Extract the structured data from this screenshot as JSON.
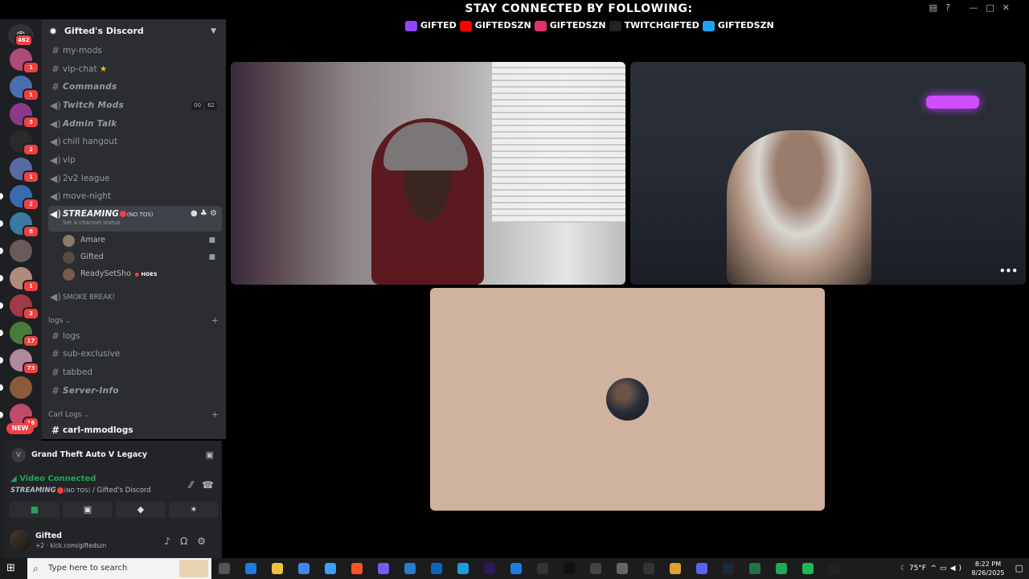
{
  "rail": {
    "home_badge": "462",
    "new_label": "NEW",
    "servers": [
      {
        "badge": "1",
        "color": "#b04a7a"
      },
      {
        "badge": "1",
        "color": "#4a6fb0"
      },
      {
        "badge": "3",
        "color": "#8a3a8a"
      },
      {
        "badge": "2",
        "color": "#2a2a2a"
      },
      {
        "badge": "1",
        "color": "#5a6aa0"
      },
      {
        "badge": "2",
        "color": "#3a6ab0"
      },
      {
        "badge": "8",
        "color": "#3a7aa0"
      },
      {
        "badge": "",
        "color": "#6a5a5a"
      },
      {
        "badge": "1",
        "color": "#b08a7a"
      },
      {
        "badge": "3",
        "color": "#a03a4a"
      },
      {
        "badge": "17",
        "color": "#4a7a3a"
      },
      {
        "badge": "73",
        "color": "#b08a9a"
      },
      {
        "badge": "",
        "color": "#8a5a3a"
      },
      {
        "badge": "16",
        "color": "#c04a6a"
      }
    ]
  },
  "server": {
    "name": "Gifted's Discord"
  },
  "channels": {
    "my_mods": "my-mods",
    "vip_chat": "vip-chat",
    "vip_star": "★",
    "commands": "Commands",
    "twitch_mods": "Twitch Mods",
    "twitch_mods_count_a": "00",
    "twitch_mods_count_b": "62",
    "admin_talk": "Admin Talk",
    "chill_hangout": "chill hangout",
    "vip": "vip",
    "league": "2v2 league",
    "move_night": "move-night",
    "streaming": "STREAMING",
    "streaming_tag": "(NO TOS)",
    "streaming_status": "Set a channel status",
    "voice_users": [
      {
        "name": "Amare",
        "color": "#8a7a6a"
      },
      {
        "name": "Gifted",
        "color": "#5a4a44"
      },
      {
        "name": "ReadySetSho",
        "color": "#7a5a4a",
        "badge": "HOES"
      }
    ],
    "smoke_break": "SMOKE BREAK!",
    "logs_category": "logs",
    "logs": "logs",
    "sub_exclusive": "sub-exclusive",
    "tabbed": "tabbed",
    "server_info": "Server-Info",
    "carl_category": "Carl Logs",
    "carl_mmodlogs": "carl-mmodlogs"
  },
  "panel": {
    "activity": "Grand Theft Auto V Legacy",
    "voice_status": "Video Connected",
    "voice_channel": "STREAMING",
    "voice_tag": "(NO TOS)",
    "voice_server": "/ Gifted's Discord",
    "user_name": "Gifted",
    "user_status": "+2 · kick.com/giftedszn"
  },
  "overlay": {
    "title": "STAY CONNECTED BY FOLLOWING:",
    "handles": [
      {
        "name": "GIFTED",
        "color": "#9146ff"
      },
      {
        "name": "GIFTEDSZN",
        "color": "#ff0000"
      },
      {
        "name": "GIFTEDSZN",
        "color": "#e1306c"
      },
      {
        "name": "TWITCHGIFTED",
        "color": "#222222"
      },
      {
        "name": "GIFTEDSZN",
        "color": "#1da1f2"
      }
    ]
  },
  "taskbar": {
    "search_placeholder": "Type here to search",
    "weather": "75°F",
    "time": "8:22 PM",
    "date": "8/26/2025"
  }
}
